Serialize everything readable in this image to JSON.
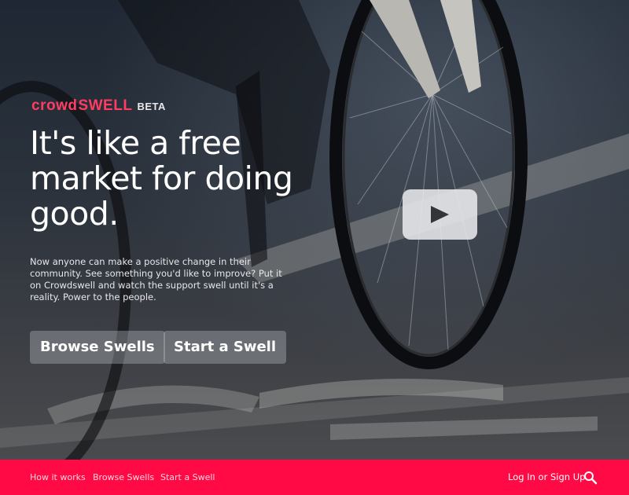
{
  "brand": {
    "word_crowd": "crowd",
    "word_swell": "SWELL",
    "badge": "BETA",
    "accent_color": "#ff0a45"
  },
  "hero": {
    "headline": "It's like a free market for doing good.",
    "description": "Now anyone can make a positive change in their community. See something you'd like to improve? Put it on Crowdswell and watch the support swell until it's a reality. Power to the people.",
    "browse_button": "Browse Swells",
    "start_button": "Start a Swell",
    "video_icon": "play-icon"
  },
  "footer": {
    "links": [
      "How it works",
      "Browse Swells",
      "Start a Swell"
    ],
    "login": "Log In or Sign Up",
    "search_icon": "search-icon"
  }
}
